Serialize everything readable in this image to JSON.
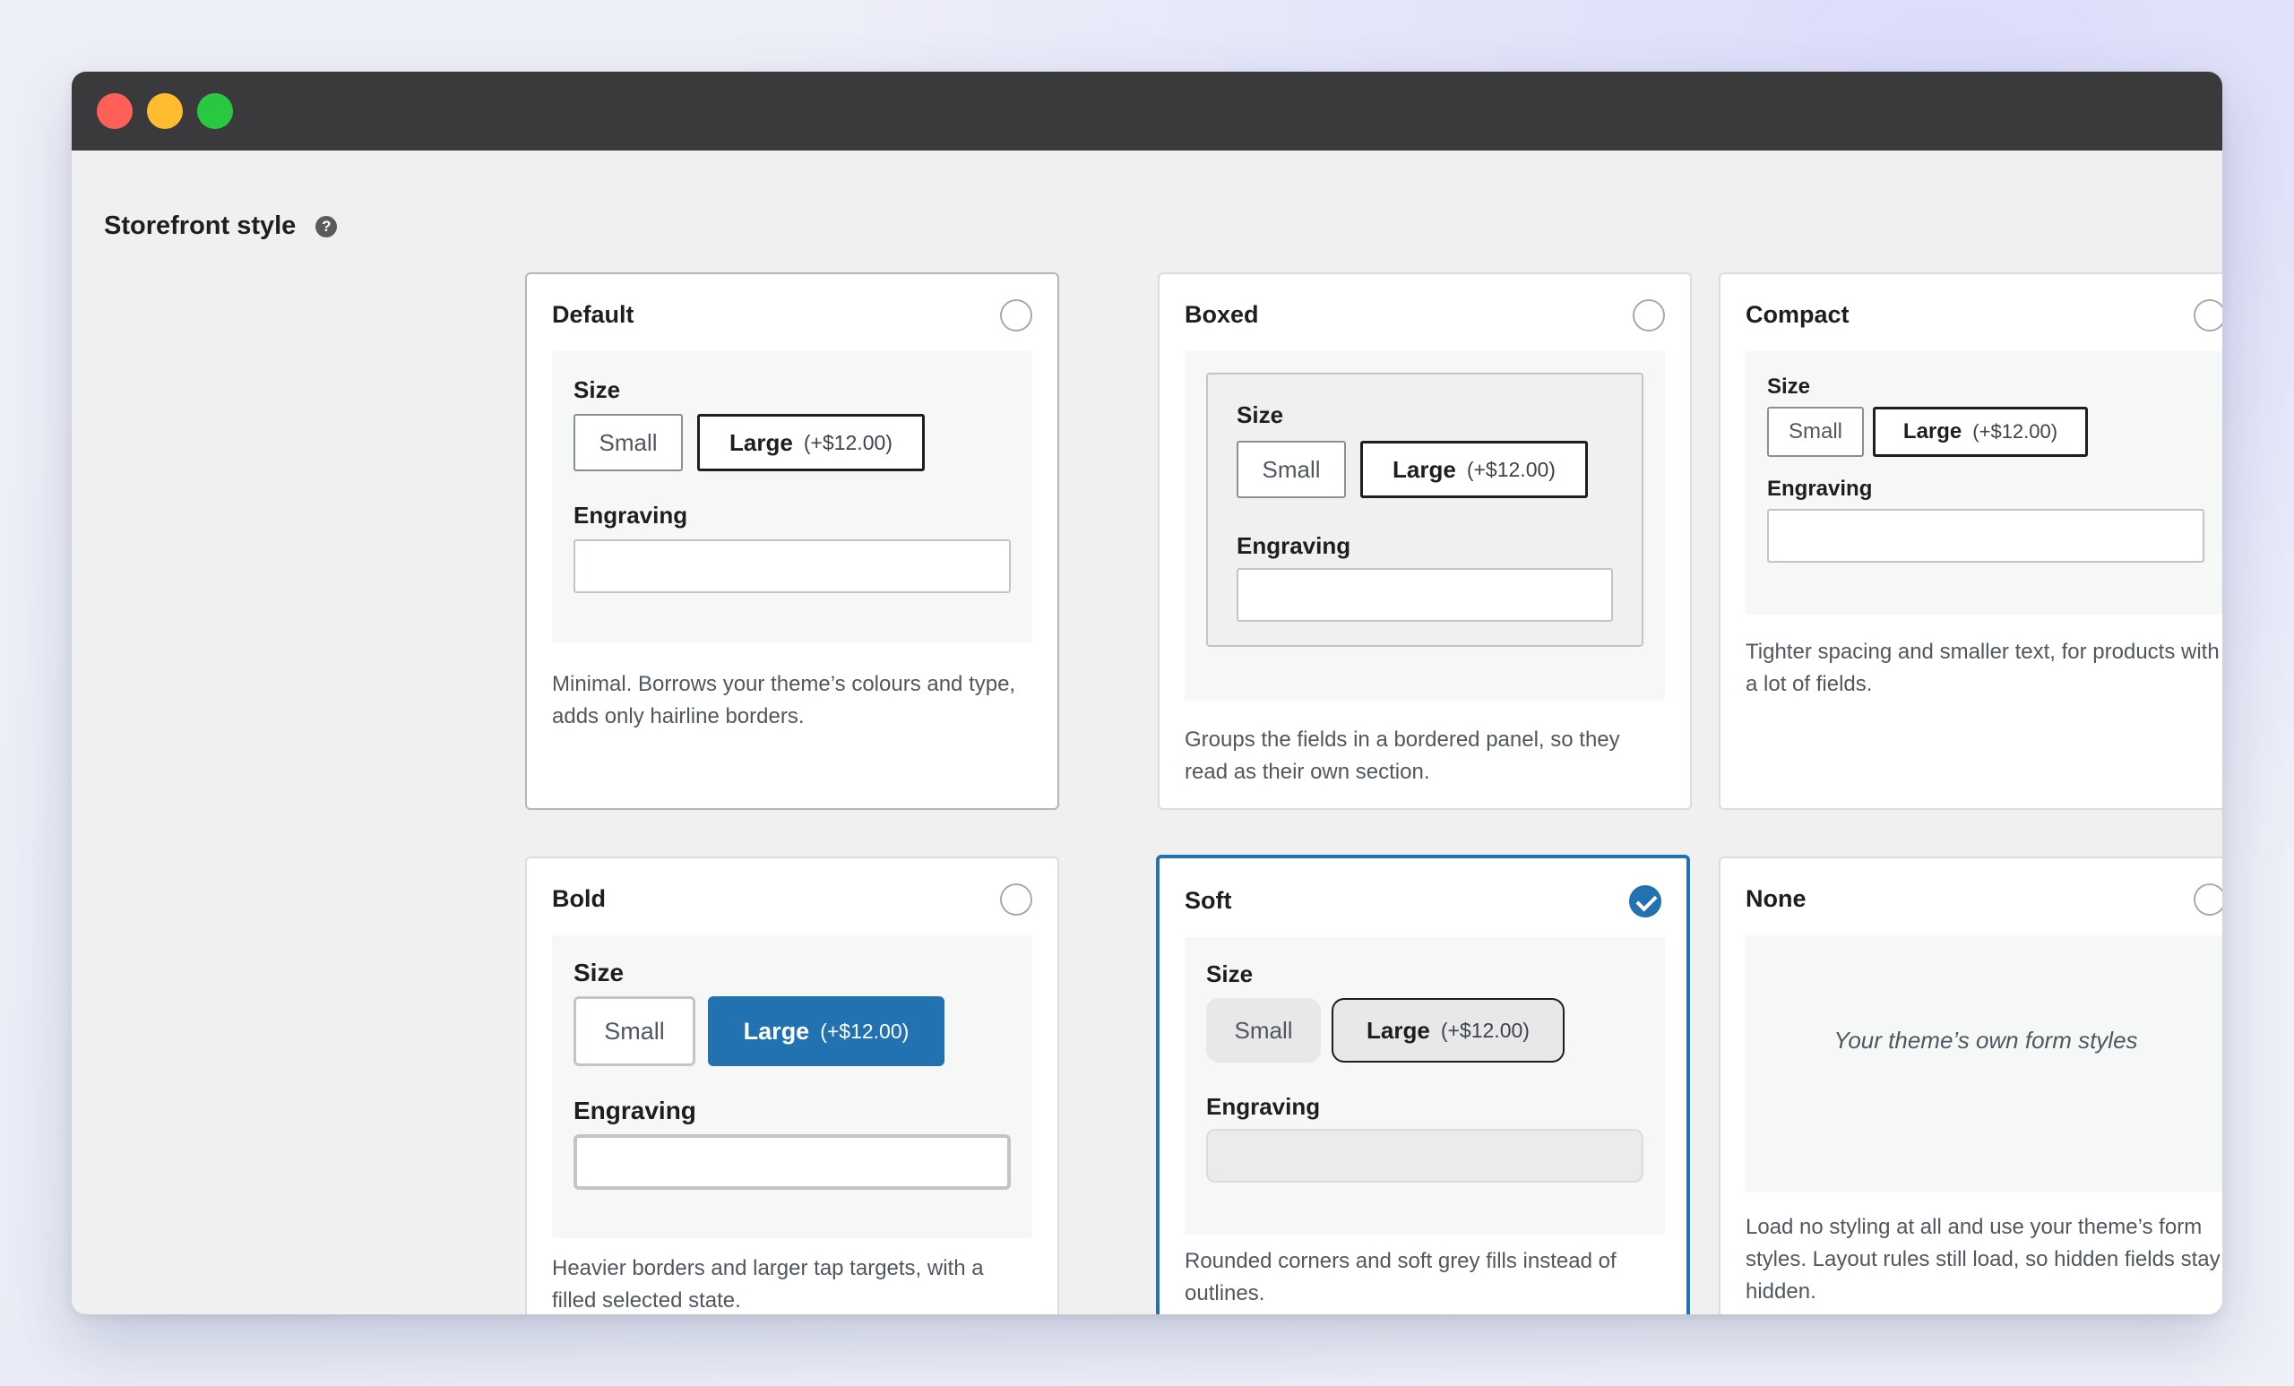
{
  "window": {
    "controls": [
      "close",
      "minimize",
      "maximize"
    ]
  },
  "section": {
    "label": "Storefront style",
    "help_icon": "?"
  },
  "common": {
    "size_label": "Size",
    "small_label": "Small",
    "large_label": "Large",
    "large_price": "(+$12.00)",
    "engraving_label": "Engraving"
  },
  "cards": {
    "default": {
      "title": "Default",
      "selected": false,
      "description": "Minimal. Borrows your theme’s colours and type, adds only hairline borders."
    },
    "boxed": {
      "title": "Boxed",
      "selected": false,
      "description": "Groups the fields in a bordered panel, so they read as their own section."
    },
    "compact": {
      "title": "Compact",
      "selected": false,
      "description": "Tighter spacing and smaller text, for products with a lot of fields."
    },
    "bold": {
      "title": "Bold",
      "selected": false,
      "description": "Heavier borders and larger tap targets, with a filled selected state."
    },
    "soft": {
      "title": "Soft",
      "selected": true,
      "description": "Rounded corners and soft grey fills instead of outlines."
    },
    "none": {
      "title": "None",
      "selected": false,
      "preview_text": "Your theme’s own form styles",
      "description": "Load no styling at all and use your theme’s form styles. Layout rules still load, so hidden fields stay hidden."
    }
  },
  "colors": {
    "accent": "#2271b1",
    "titlebar": "#3a3a3c",
    "preview_bg": "#f6f7f7"
  }
}
